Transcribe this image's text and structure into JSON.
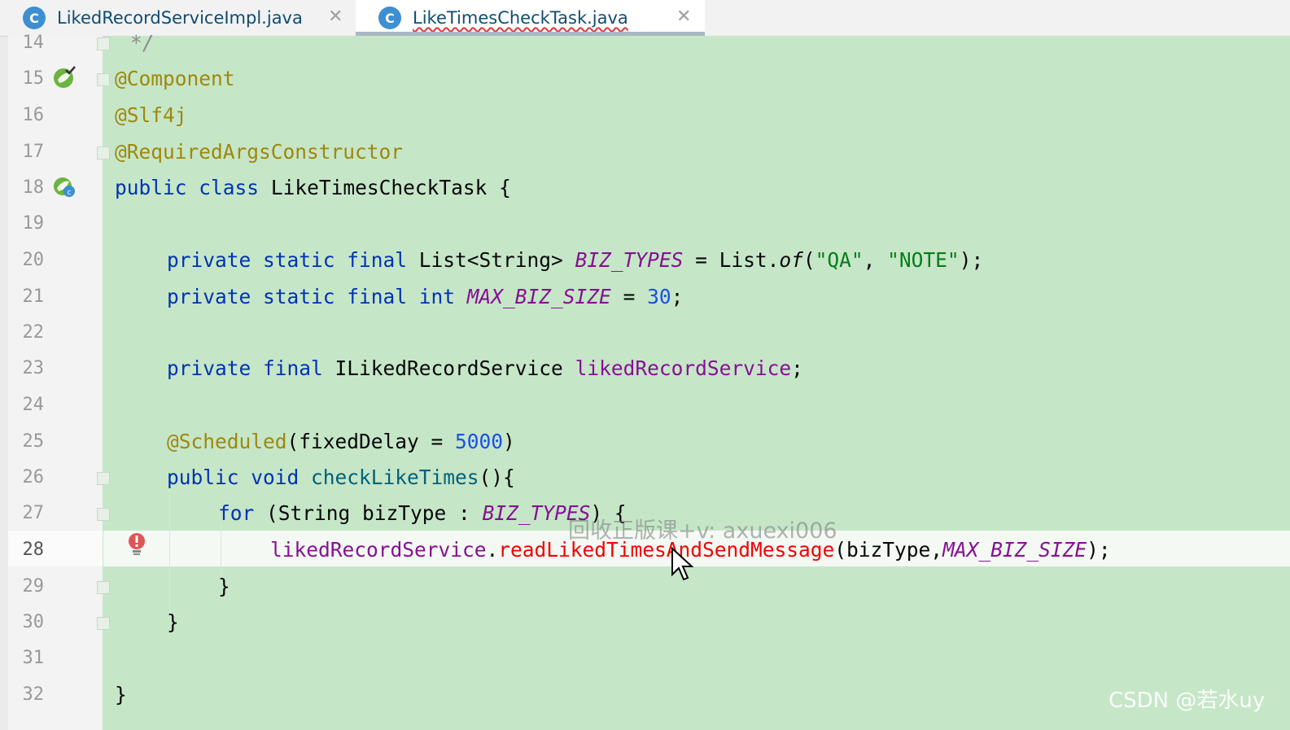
{
  "tabs": [
    {
      "label": "LikedRecordServiceImpl.java",
      "icon": "C",
      "active": false
    },
    {
      "label": "LikeTimesCheckTask.java",
      "icon": "C",
      "active": true
    }
  ],
  "close_glyph": "✕",
  "line_numbers": [
    "14",
    "15",
    "16",
    "17",
    "18",
    "19",
    "20",
    "21",
    "22",
    "23",
    "24",
    "25",
    "26",
    "27",
    "28",
    "29",
    "30",
    "31",
    "32"
  ],
  "code": {
    "l14_comment": "*/",
    "l15_ann": "@Component",
    "l16_ann": "@Slf4j",
    "l17_ann": "@RequiredArgsConstructor",
    "l18_kw1": "public",
    "l18_kw2": "class",
    "l18_rest": "LikeTimesCheckTask {",
    "l20_kw": "private static final",
    "l20_type": "List<String>",
    "l20_const": "BIZ_TYPES",
    "l20_eq": "= List.",
    "l20_of": "of",
    "l20_open": "(",
    "l20_s1": "\"QA\"",
    "l20_comma": ", ",
    "l20_s2": "\"NOTE\"",
    "l20_close": ");",
    "l21_kw": "private static final int",
    "l21_const": "MAX_BIZ_SIZE",
    "l21_eq": "=",
    "l21_num": "30",
    "l21_semi": ";",
    "l23_kw": "private final",
    "l23_type": "ILikedRecordService",
    "l23_field": "likedRecordService",
    "l23_semi": ";",
    "l25_ann": "@Scheduled",
    "l25_args": "(fixedDelay = ",
    "l25_num": "5000",
    "l25_close": ")",
    "l26_kw": "public void",
    "l26_meth": "checkLikeTimes",
    "l26_rest": "(){",
    "l27_kw": "for",
    "l27_mid": "(String bizType :",
    "l27_const": "BIZ_TYPES",
    "l27_rest": ") {",
    "l28_field": "likedRecordService",
    "l28_dot": ".",
    "l28_err": "readLikedTimesAndSendMessage",
    "l28_args": "(bizType,",
    "l28_const": "MAX_BIZ_SIZE",
    "l28_close": ");",
    "l29": "}",
    "l30": "}",
    "l32": "}"
  },
  "watermark": "回收正版课+v: axuexi006",
  "csdn": "CSDN @若水uy",
  "colors": {
    "background": "#c6e6c8",
    "keyword": "#0033b3",
    "annotation": "#9e880d",
    "constant": "#871094",
    "string": "#067d17",
    "number": "#1750eb",
    "error": "#f50000"
  }
}
